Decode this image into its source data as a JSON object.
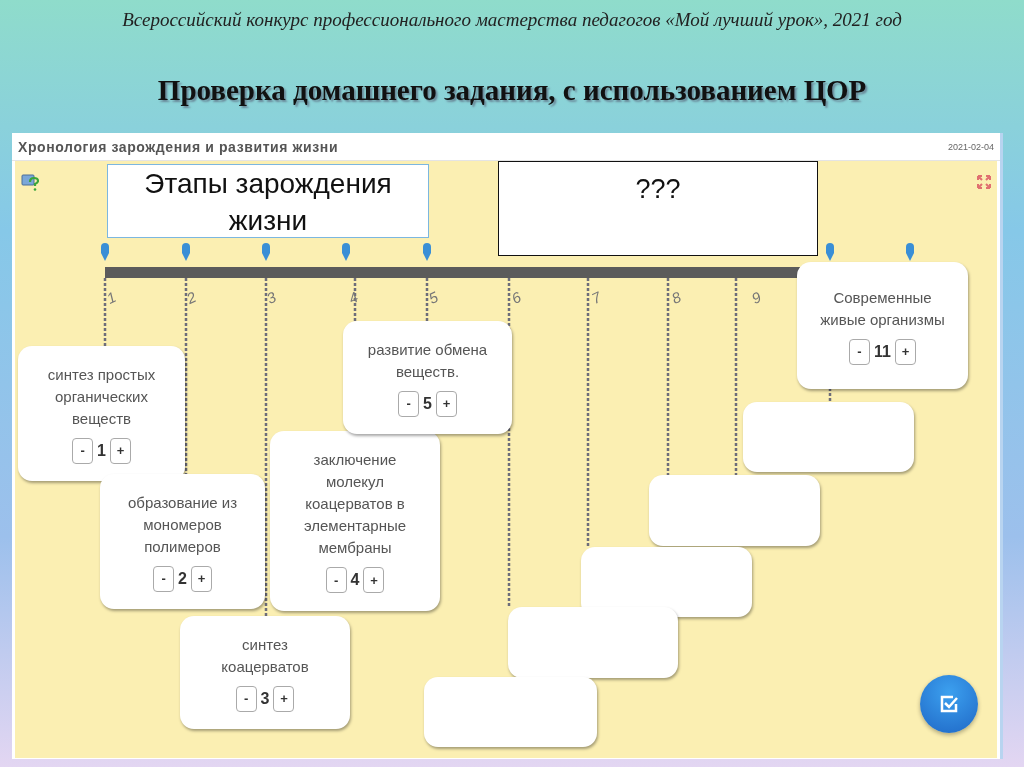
{
  "slide": {
    "subtitle": "Всероссийский конкурс профессионального мастерства педагогов «Мой лучший урок», 2021 год",
    "title": "Проверка домашнего задания, с использованием ЦОР"
  },
  "app": {
    "title": "Хронология зарождения и развития жизни",
    "date": "2021-02-04",
    "heading": "Этапы зарождения жизни",
    "question": "???",
    "tick_labels": [
      "1",
      "2",
      "3",
      "4",
      "5",
      "6",
      "7",
      "8",
      "9"
    ],
    "cards": [
      {
        "kind": "filled",
        "text": "синтез простых органических веществ",
        "minus": "-",
        "value": "1",
        "plus": "+"
      },
      {
        "kind": "filled",
        "text": "образование из мономеров полимеров",
        "minus": "-",
        "value": "2",
        "plus": "+"
      },
      {
        "kind": "filled",
        "text": "синтез коацерватов",
        "minus": "-",
        "value": "3",
        "plus": "+"
      },
      {
        "kind": "filled",
        "text": "заключение молекул коацерватов в элементарные мембраны",
        "minus": "-",
        "value": "4",
        "plus": "+"
      },
      {
        "kind": "filled",
        "text": "развитие обмена веществ.",
        "minus": "-",
        "value": "5",
        "plus": "+"
      },
      {
        "kind": "filled",
        "text": "Современные живые организмы",
        "minus": "-",
        "value": "11",
        "plus": "+"
      },
      {
        "kind": "empty"
      },
      {
        "kind": "empty"
      },
      {
        "kind": "empty"
      },
      {
        "kind": "empty"
      },
      {
        "kind": "empty"
      }
    ]
  }
}
